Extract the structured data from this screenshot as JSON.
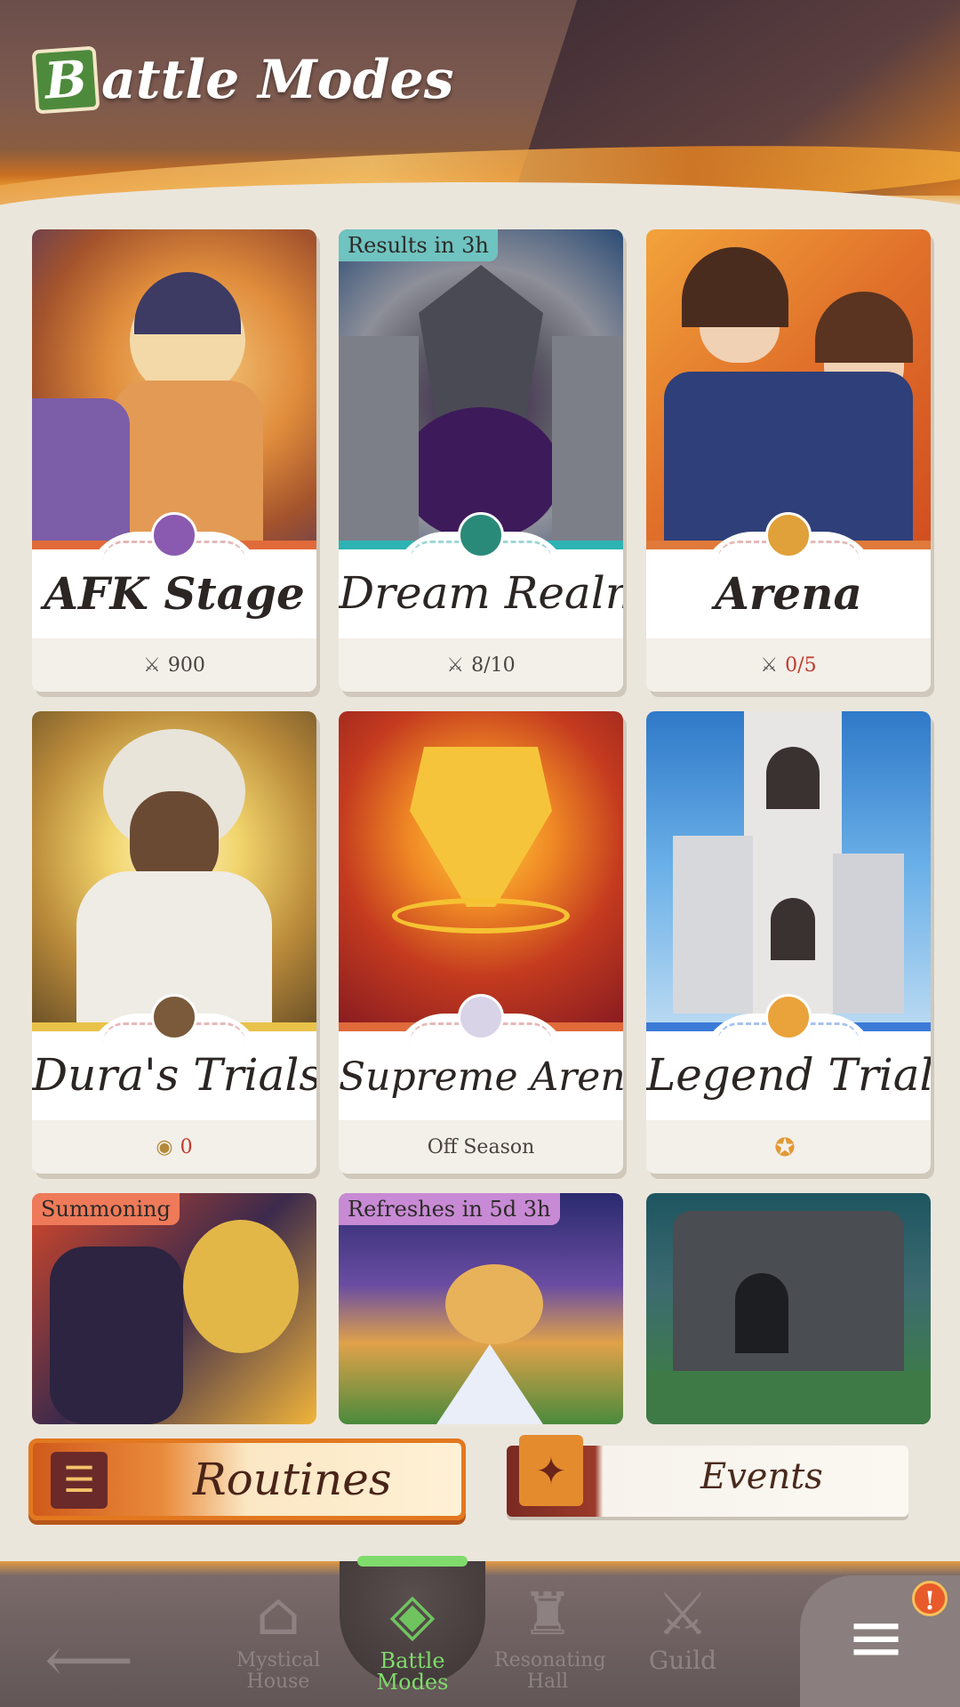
{
  "header": {
    "title_initial": "B",
    "title_rest": "attle Modes"
  },
  "cards": [
    {
      "name": "AFK Stage",
      "footer_icon": "crossed-swords-icon",
      "footer_value": "900",
      "footer_color": "#4a4240"
    },
    {
      "name": "Dream Realm",
      "tag": "Results in 3h",
      "footer_icon": "crossed-swords-icon",
      "footer_value": "8/10",
      "footer_color": "#4a4240"
    },
    {
      "name": "Arena",
      "footer_icon": "crossed-swords-icon",
      "footer_value": "0/5",
      "footer_color": "#c0392b"
    },
    {
      "name": "Dura's Trials",
      "footer_icon": "coin-icon",
      "footer_value": "0",
      "footer_color": "#c0392b"
    },
    {
      "name": "Supreme Arena",
      "footer_value": "Off Season",
      "footer_color": "#4a4240"
    },
    {
      "name": "Legend Trial",
      "footer_icon": "medal-icon",
      "footer_color": "#4a4240"
    },
    {
      "tag": "Summoning"
    },
    {
      "tag": "Refreshes in 5d 3h"
    },
    {}
  ],
  "sections": {
    "routines": "Routines",
    "events": "Events"
  },
  "nav": {
    "back": "back-arrow-icon",
    "items": [
      {
        "label": "Mystical House",
        "icon": "house-icon"
      },
      {
        "label": "Battle Modes",
        "icon": "battle-modes-icon"
      },
      {
        "label": "Resonating Hall",
        "icon": "helmet-icon"
      },
      {
        "label": "Guild",
        "icon": "crossed-swords-icon"
      }
    ],
    "menu_alert": "!"
  },
  "colors": {
    "accent_green": "#7fdc6c",
    "alert": "#e85a2a",
    "routines_orange": "#e2781f"
  }
}
